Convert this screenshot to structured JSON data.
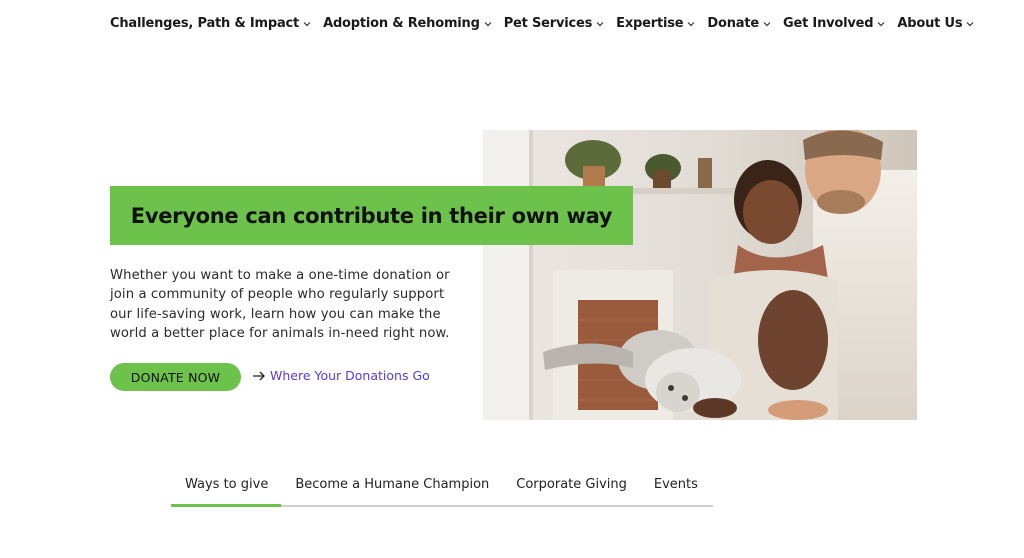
{
  "nav": {
    "items": [
      {
        "label": "Challenges, Path & Impact"
      },
      {
        "label": "Adoption & Rehoming"
      },
      {
        "label": "Pet Services"
      },
      {
        "label": "Expertise"
      },
      {
        "label": "Donate"
      },
      {
        "label": "Get Involved"
      },
      {
        "label": "About Us"
      }
    ]
  },
  "hero": {
    "headline": "Everyone can contribute in their own way",
    "description": "Whether you want to make a one-time donation or join a community of people who regularly support our life-saving work, learn how you can make the world a better place for animals in-need right now.",
    "donate_label": "DONATE NOW",
    "where_label": "Where Your Donations Go"
  },
  "tabs": {
    "items": [
      {
        "label": "Ways to give"
      },
      {
        "label": "Become a Humane Champion"
      },
      {
        "label": "Corporate Giving"
      },
      {
        "label": "Events"
      }
    ],
    "active_index": 0
  },
  "colors": {
    "accent": "#6cc24a",
    "link": "#5a3bd9",
    "text": "#1a1a1a"
  }
}
